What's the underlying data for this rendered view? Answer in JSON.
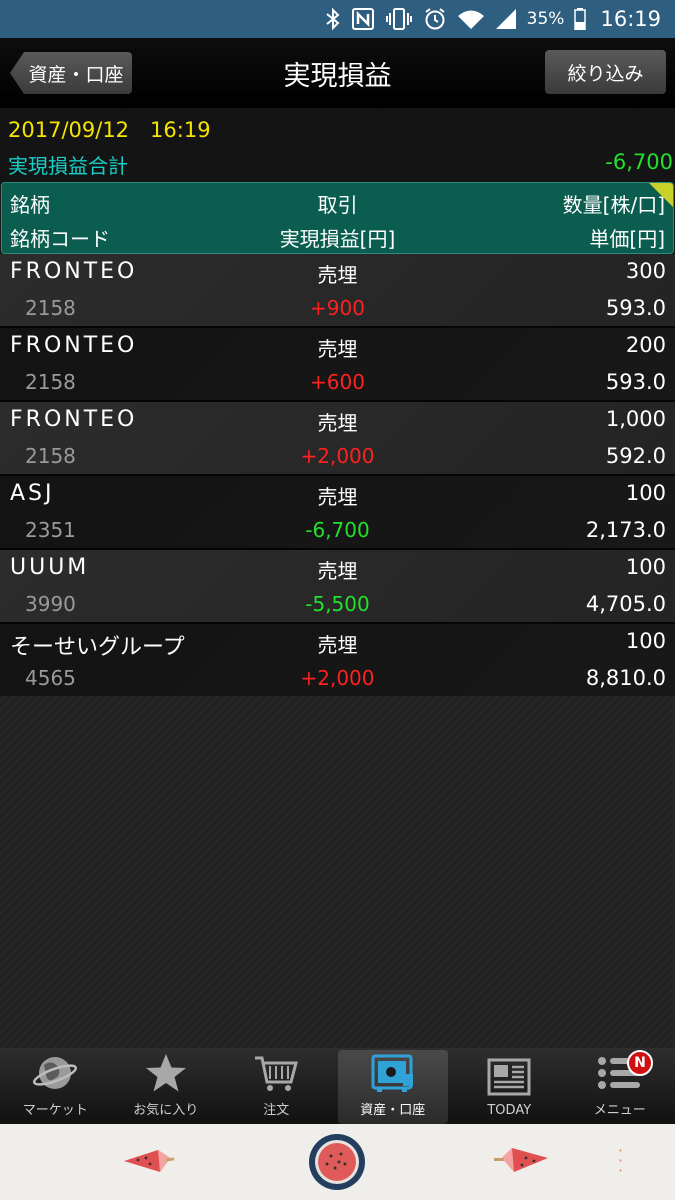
{
  "status_bar": {
    "icons": [
      "bluetooth-icon",
      "nfc-icon",
      "vibrate-icon",
      "alarm-icon",
      "wifi-icon",
      "signal-icon"
    ],
    "battery_pct": "35%",
    "time": "16:19"
  },
  "header": {
    "back_label": "資産・口座",
    "title": "実現損益",
    "filter_label": "絞り込み"
  },
  "summary": {
    "datetime": "2017/09/12　16:19",
    "total_label": "実現損益合計",
    "total_value": "-6,700"
  },
  "columns": {
    "name": "銘柄",
    "trade": "取引",
    "qty": "数量[株/口]",
    "code": "銘柄コード",
    "pnl": "実現損益[円]",
    "price": "単価[円]"
  },
  "rows": [
    {
      "name": "FRONTEO",
      "code": "2158",
      "trade": "売埋",
      "pnl": "+900",
      "qty": "300",
      "price": "593.0"
    },
    {
      "name": "FRONTEO",
      "code": "2158",
      "trade": "売埋",
      "pnl": "+600",
      "qty": "200",
      "price": "593.0"
    },
    {
      "name": "FRONTEO",
      "code": "2158",
      "trade": "売埋",
      "pnl": "+2,000",
      "qty": "1,000",
      "price": "592.0"
    },
    {
      "name": "ASJ",
      "code": "2351",
      "trade": "売埋",
      "pnl": "-6,700",
      "qty": "100",
      "price": "2,173.0"
    },
    {
      "name": "UUUM",
      "code": "3990",
      "trade": "売埋",
      "pnl": "-5,500",
      "qty": "100",
      "price": "4,705.0"
    },
    {
      "name": "そーせいグループ",
      "code": "4565",
      "trade": "売埋",
      "pnl": "+2,000",
      "qty": "100",
      "price": "8,810.0"
    }
  ],
  "tabs": [
    {
      "label": "マーケット",
      "icon": "globe-icon"
    },
    {
      "label": "お気に入り",
      "icon": "star-icon"
    },
    {
      "label": "注文",
      "icon": "cart-icon"
    },
    {
      "label": "資産・口座",
      "icon": "safe-icon"
    },
    {
      "label": "TODAY",
      "icon": "newspaper-icon"
    },
    {
      "label": "メニュー",
      "icon": "menu-icon",
      "badge": "N"
    }
  ],
  "colors": {
    "positive": "#ff2020",
    "negative": "#22e12a",
    "header_bg": "#0b5d4f",
    "datetime": "#f5e400",
    "total_label": "#18d0c8"
  }
}
